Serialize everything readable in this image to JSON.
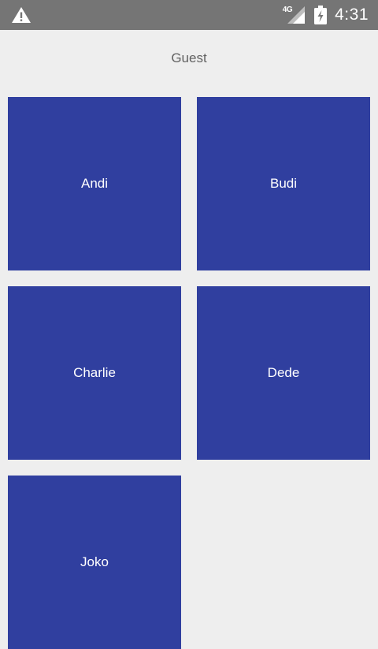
{
  "status_bar": {
    "network_type": "4G",
    "time": "4:31",
    "icons": [
      "warning-icon",
      "signal-icon",
      "battery-charging-icon"
    ]
  },
  "page": {
    "title": "Guest"
  },
  "guests": [
    {
      "name": "Andi"
    },
    {
      "name": "Budi"
    },
    {
      "name": "Charlie"
    },
    {
      "name": "Dede"
    },
    {
      "name": "Joko"
    }
  ],
  "colors": {
    "status_bar": "#757575",
    "background": "#eeeeee",
    "tile": "#303f9f",
    "tile_text": "#ffffff",
    "title_text": "#616161"
  }
}
